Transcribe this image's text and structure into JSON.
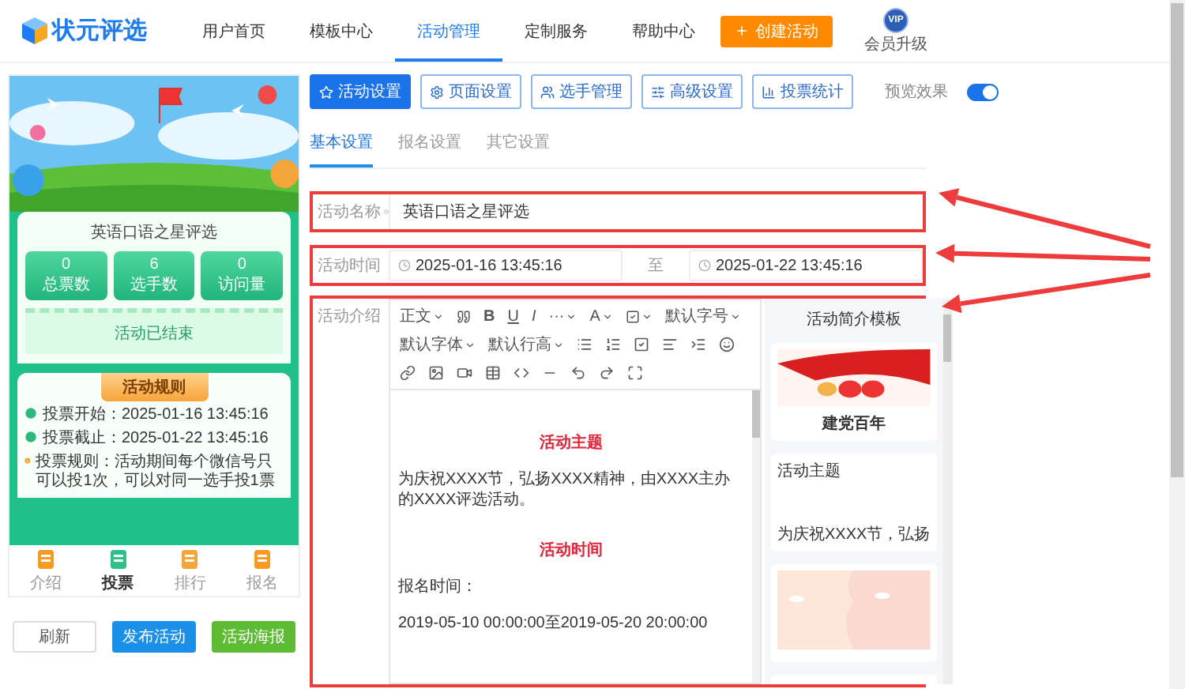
{
  "header": {
    "logo": "状元评选",
    "nav": [
      {
        "label": "用户首页",
        "selected": false
      },
      {
        "label": "模板中心",
        "selected": false
      },
      {
        "label": "活动管理",
        "selected": true
      },
      {
        "label": "定制服务",
        "selected": false
      },
      {
        "label": "帮助中心",
        "selected": false
      }
    ],
    "create_button": "创建活动",
    "vip": {
      "badge": "VIP",
      "label": "会员升级"
    }
  },
  "preview": {
    "card_title": "英语口语之星评选",
    "stats": [
      {
        "value": "0",
        "label": "总票数"
      },
      {
        "value": "6",
        "label": "选手数"
      },
      {
        "value": "0",
        "label": "访问量"
      }
    ],
    "status": "活动已结束",
    "rules_title": "活动规则",
    "rules": [
      {
        "kind": "time",
        "text": "投票开始：2025-01-16 13:45:16"
      },
      {
        "kind": "time",
        "text": "投票截止：2025-01-22 13:45:16"
      },
      {
        "kind": "info",
        "text": "投票规则：活动期间每个微信号只可以投1次，可以对同一选手投1票"
      }
    ],
    "bottom_nav": [
      {
        "label": "介绍",
        "selected": false
      },
      {
        "label": "投票",
        "selected": true
      },
      {
        "label": "排行",
        "selected": false
      },
      {
        "label": "报名",
        "selected": false
      }
    ]
  },
  "actions": [
    {
      "label": "刷新",
      "kind": "default"
    },
    {
      "label": "发布活动",
      "kind": "primary"
    },
    {
      "label": "活动海报",
      "kind": "success"
    }
  ],
  "settings_tabs": [
    {
      "label": "活动设置",
      "selected": true
    },
    {
      "label": "页面设置",
      "selected": false
    },
    {
      "label": "选手管理",
      "selected": false
    },
    {
      "label": "高级设置",
      "selected": false
    },
    {
      "label": "投票统计",
      "selected": false
    }
  ],
  "preview_toggle": {
    "label": "预览效果",
    "on": true
  },
  "sub_tabs": [
    {
      "label": "基本设置",
      "selected": true
    },
    {
      "label": "报名设置",
      "selected": false
    },
    {
      "label": "其它设置",
      "selected": false
    }
  ],
  "form": {
    "name": {
      "label": "活动名称",
      "value": "英语口语之星评选"
    },
    "time": {
      "label": "活动时间",
      "start": "2025-01-16 13:45:16",
      "separator": "至",
      "end": "2025-01-22 13:45:16"
    },
    "intro": {
      "label": "活动介绍",
      "toolbar": {
        "paragraph": "正文",
        "bold": "B",
        "underline": "U",
        "italic": "I",
        "more": "···",
        "font_color": "A",
        "font_size": "默认字号",
        "font_family": "默认字体",
        "line_height": "默认行高"
      },
      "content": [
        {
          "kind": "heading",
          "text": "活动主题"
        },
        {
          "kind": "paragraph",
          "text": "为庆祝XXXX节，弘扬XXXX精神，由XXXX主办的XXXX评选活动。"
        },
        {
          "kind": "heading",
          "text": "活动时间"
        },
        {
          "kind": "paragraph",
          "text": "报名时间："
        },
        {
          "kind": "paragraph",
          "text": "2019-05-10 00:00:00至2019-05-20 20:00:00"
        }
      ]
    }
  },
  "templates": {
    "title": "活动简介模板",
    "cards": [
      {
        "kind": "picture",
        "caption": "建党百年"
      },
      {
        "kind": "text",
        "title": "活动主题",
        "text": "为庆祝XXXX节，弘扬"
      },
      {
        "kind": "picture"
      },
      {
        "kind": "blank"
      }
    ]
  }
}
